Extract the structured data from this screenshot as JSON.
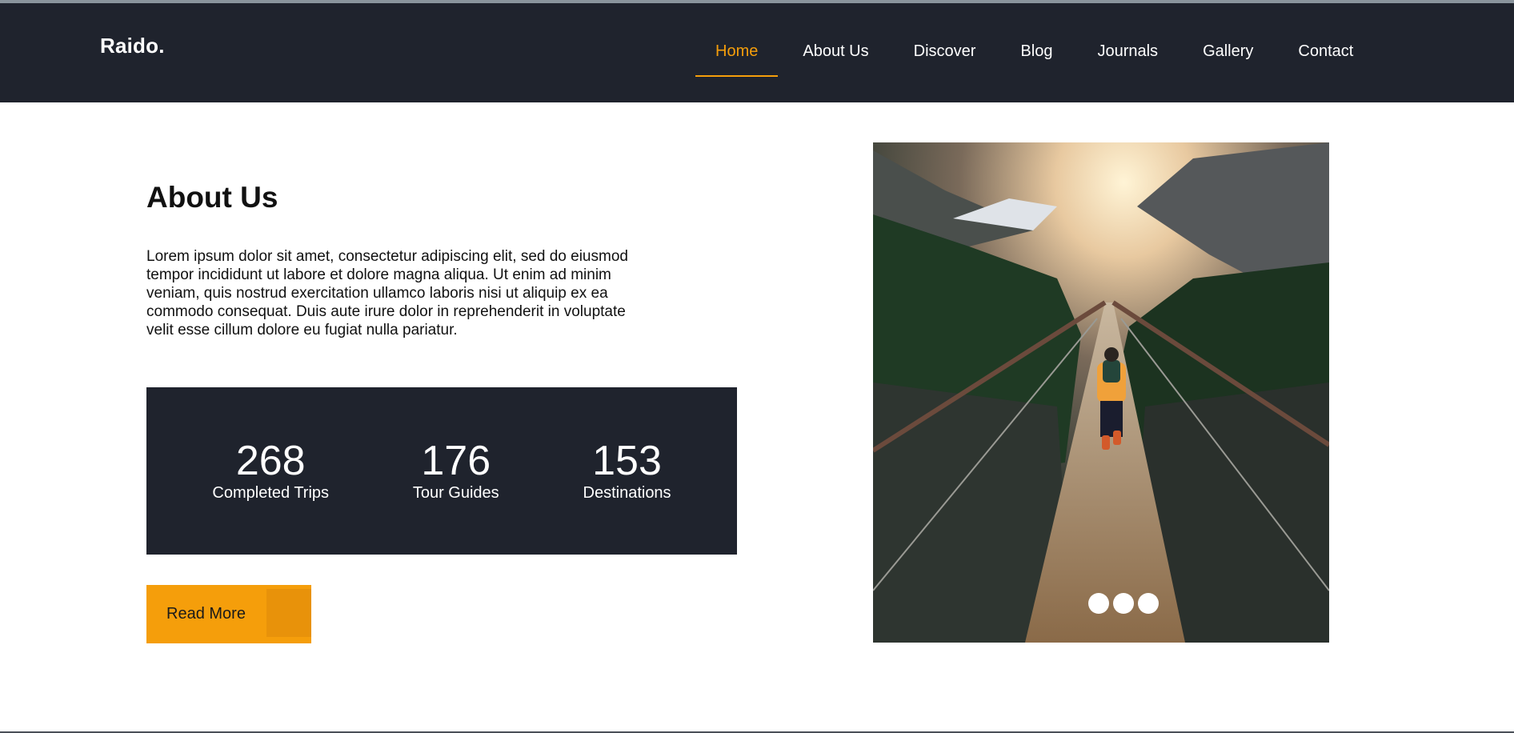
{
  "brand": "Raido.",
  "nav": {
    "items": [
      {
        "label": "Home",
        "active": true
      },
      {
        "label": "About Us",
        "active": false
      },
      {
        "label": "Discover",
        "active": false
      },
      {
        "label": "Blog",
        "active": false
      },
      {
        "label": "Journals",
        "active": false
      },
      {
        "label": "Gallery",
        "active": false
      },
      {
        "label": "Contact",
        "active": false
      }
    ]
  },
  "about": {
    "title": "About Us",
    "text": "Lorem ipsum dolor sit amet, consectetur adipiscing elit, sed do eiusmod tempor incididunt ut labore et dolore magna aliqua. Ut enim ad minim veniam, quis nostrud exercitation ullamco laboris nisi ut aliquip ex ea commodo consequat. Duis aute irure dolor in reprehenderit in voluptate velit esse cillum dolore eu fugiat nulla pariatur."
  },
  "stats": [
    {
      "value": "268",
      "label": "Completed Trips"
    },
    {
      "value": "176",
      "label": "Tour Guides"
    },
    {
      "value": "153",
      "label": "Destinations"
    }
  ],
  "read_more_label": "Read More",
  "carousel": {
    "slide_count": 3
  },
  "colors": {
    "navbar_bg": "#1f232d",
    "accent": "#f59e0b",
    "text": "#111111",
    "white": "#ffffff"
  }
}
